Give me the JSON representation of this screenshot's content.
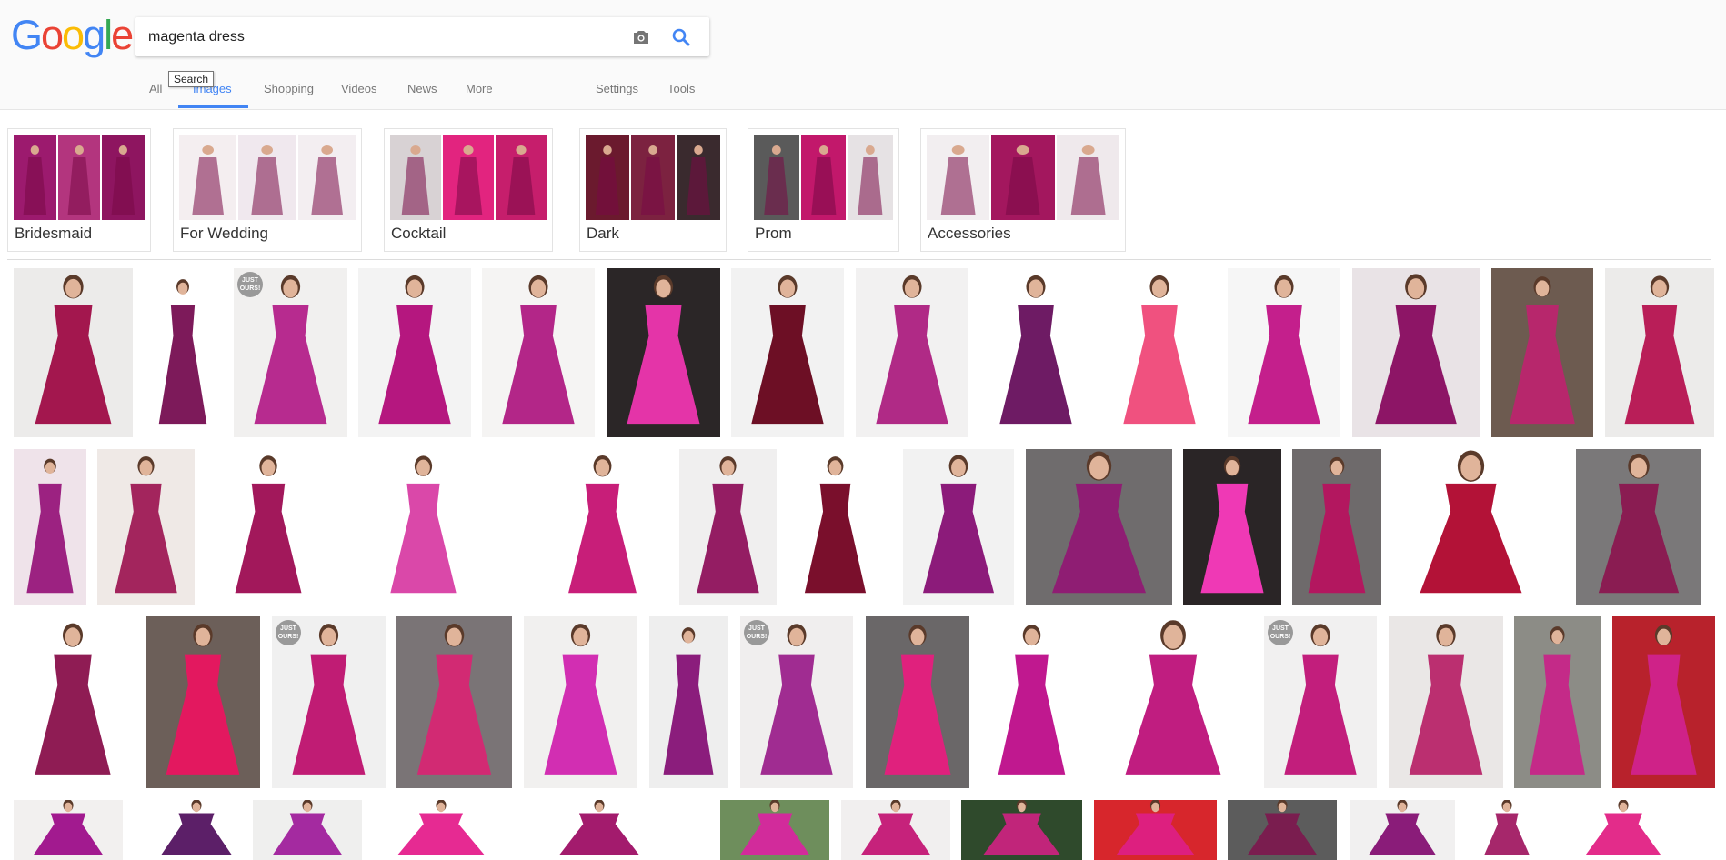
{
  "logo": {
    "letters": [
      "G",
      "o",
      "o",
      "g",
      "l",
      "e"
    ],
    "colors": [
      "#4285f4",
      "#ea4335",
      "#fbbc05",
      "#4285f4",
      "#34a853",
      "#ea4335"
    ]
  },
  "search": {
    "query": "magenta dress",
    "tooltip": "Search"
  },
  "nav": {
    "tabs": [
      {
        "label": "All"
      },
      {
        "label": "Images"
      },
      {
        "label": "Shopping"
      },
      {
        "label": "Videos"
      },
      {
        "label": "News"
      },
      {
        "label": "More"
      },
      {
        "label": "Settings"
      },
      {
        "label": "Tools"
      }
    ],
    "active_index": 1,
    "accent": "#4285f4"
  },
  "related": [
    {
      "label": "Bridesmaid",
      "colors": [
        "#9c1a6e",
        "#b3357e",
        "#8e1560"
      ]
    },
    {
      "label": "For Wedding",
      "colors": [
        "#f4eef0",
        "#f0e8ee",
        "#f3eef1"
      ]
    },
    {
      "label": "Cocktail",
      "colors": [
        "#d8d2d4",
        "#e2247f",
        "#c61e6c"
      ]
    },
    {
      "label": "Dark",
      "colors": [
        "#6b1a2e",
        "#7c2240",
        "#3a2a2e"
      ]
    },
    {
      "label": "Prom",
      "colors": [
        "#5a5a5a",
        "#c2186b",
        "#e6e2e4"
      ]
    },
    {
      "label": "Accessories",
      "colors": [
        "#f2eef0",
        "#a3175e",
        "#efe9ec"
      ]
    }
  ],
  "badge_text": "JUST OURS!",
  "results": [
    [
      {
        "bg": "#ecebea",
        "dress": "#a3174e"
      },
      {
        "bg": "#ffffff",
        "dress": "#7d1a5a"
      },
      {
        "bg": "#f1f0ef",
        "dress": "#b72b8f",
        "badge": true
      },
      {
        "bg": "#f3f3f3",
        "dress": "#b5177f"
      },
      {
        "bg": "#f5f4f3",
        "dress": "#b32688"
      },
      {
        "bg": "#2b2627",
        "dress": "#e434a8"
      },
      {
        "bg": "#f2f2f2",
        "dress": "#6d0f25"
      },
      {
        "bg": "#f2f1f1",
        "dress": "#b02a86"
      },
      {
        "bg": "#ffffff",
        "dress": "#6e1b64"
      },
      {
        "bg": "#ffffff",
        "dress": "#f0517f"
      },
      {
        "bg": "#f6f6f6",
        "dress": "#c41f8c"
      },
      {
        "bg": "#e9e3e6",
        "dress": "#8d1566"
      },
      {
        "bg": "#6d5b50",
        "dress": "#b7276c"
      },
      {
        "bg": "#ecebea",
        "dress": "#b91e58"
      }
    ],
    [
      {
        "bg": "#efe3ea",
        "dress": "#9c2281"
      },
      {
        "bg": "#efe9e6",
        "dress": "#a3255d"
      },
      {
        "bg": "#ffffff",
        "dress": "#a2185b"
      },
      {
        "bg": "#ffffff",
        "dress": "#da48a9"
      },
      {
        "bg": "#ffffff",
        "dress": "#c81e79"
      },
      {
        "bg": "#f0efef",
        "dress": "#941d63"
      },
      {
        "bg": "#ffffff",
        "dress": "#7a0f2c"
      },
      {
        "bg": "#f2f2f2",
        "dress": "#8c1b7a"
      },
      {
        "bg": "#6f6c6d",
        "dress": "#8f1d73"
      },
      {
        "bg": "#2a2526",
        "dress": "#ef39b5"
      },
      {
        "bg": "#6e6a6b",
        "dress": "#b3175f"
      },
      {
        "bg": "#ffffff",
        "dress": "#b31237"
      },
      {
        "bg": "#7a7879",
        "dress": "#8a1c52"
      }
    ],
    [
      {
        "bg": "#ffffff",
        "dress": "#8f1c54"
      },
      {
        "bg": "#6c5f59",
        "dress": "#e3185f"
      },
      {
        "bg": "#f0f0f0",
        "dress": "#c01c74",
        "badge": true
      },
      {
        "bg": "#7a7476",
        "dress": "#d22a73"
      },
      {
        "bg": "#f1f0ef",
        "dress": "#d22eb2"
      },
      {
        "bg": "#eeeeee",
        "dress": "#8b1d7c"
      },
      {
        "bg": "#f0eeee",
        "dress": "#a02c91",
        "badge": true
      },
      {
        "bg": "#6a6768",
        "dress": "#e0217d"
      },
      {
        "bg": "#ffffff",
        "dress": "#c0188f"
      },
      {
        "bg": "#ffffff",
        "dress": "#c01d80"
      },
      {
        "bg": "#f1f0f0",
        "dress": "#c21e7c",
        "badge": true
      },
      {
        "bg": "#eae7e6",
        "dress": "#bb2f70"
      },
      {
        "bg": "#8c8c86",
        "dress": "#c42a88"
      },
      {
        "bg": "#b8222c",
        "dress": "#cf2288"
      }
    ],
    [
      {
        "bg": "#f2f0ef",
        "dress": "#a21a8f"
      },
      {
        "bg": "#ffffff",
        "dress": "#5c1f68"
      },
      {
        "bg": "#efefee",
        "dress": "#a42aa0"
      },
      {
        "bg": "#ffffff",
        "dress": "#e62a92"
      },
      {
        "bg": "#ffffff",
        "dress": "#a31b6d"
      },
      {
        "bg": "#6e8e5c",
        "dress": "#d22b9b"
      },
      {
        "bg": "#f1efef",
        "dress": "#c6227b"
      },
      {
        "bg": "#2f4a2c",
        "dress": "#c1257a"
      },
      {
        "bg": "#d7262c",
        "dress": "#dd1f7f"
      },
      {
        "bg": "#5c5c5c",
        "dress": "#7a1d4f"
      },
      {
        "bg": "#f1f0f0",
        "dress": "#8a1c79"
      },
      {
        "bg": "#ffffff",
        "dress": "#a6276b"
      },
      {
        "bg": "#ffffff",
        "dress": "#e32c8a"
      }
    ]
  ]
}
